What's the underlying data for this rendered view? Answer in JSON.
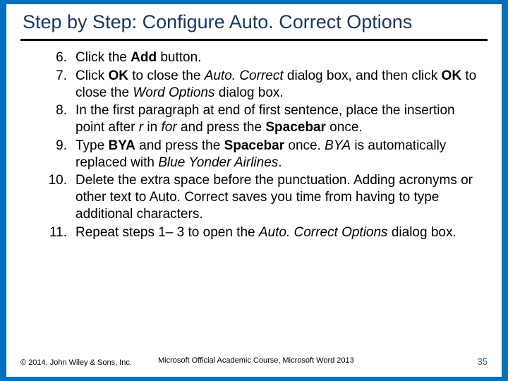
{
  "title": "Step by Step: Configure Auto. Correct Options",
  "steps": [
    {
      "num": "6.",
      "parts": [
        {
          "t": "Click the "
        },
        {
          "t": "Add",
          "b": true
        },
        {
          "t": " button."
        }
      ]
    },
    {
      "num": "7.",
      "parts": [
        {
          "t": "Click "
        },
        {
          "t": "OK",
          "b": true
        },
        {
          "t": " to close the "
        },
        {
          "t": "Auto. Correct",
          "i": true
        },
        {
          "t": " dialog box, and then click "
        },
        {
          "t": "OK",
          "b": true
        },
        {
          "t": " to close the "
        },
        {
          "t": "Word Options",
          "i": true
        },
        {
          "t": " dialog box."
        }
      ]
    },
    {
      "num": "8.",
      "parts": [
        {
          "t": "In the first paragraph at end of first sentence, place the insertion point after "
        },
        {
          "t": "r",
          "i": true
        },
        {
          "t": " in "
        },
        {
          "t": "for",
          "i": true
        },
        {
          "t": " and press the "
        },
        {
          "t": "Spacebar",
          "b": true
        },
        {
          "t": " once."
        }
      ]
    },
    {
      "num": "9.",
      "parts": [
        {
          "t": "Type "
        },
        {
          "t": "BYA",
          "b": true
        },
        {
          "t": " and press the "
        },
        {
          "t": "Spacebar",
          "b": true
        },
        {
          "t": " once. "
        },
        {
          "t": "BYA",
          "i": true
        },
        {
          "t": " is automatically replaced with "
        },
        {
          "t": "Blue Yonder Airlines",
          "i": true
        },
        {
          "t": "."
        }
      ]
    },
    {
      "num": "10.",
      "parts": [
        {
          "t": "Delete the extra space before the punctuation. Adding acronyms or other text to Auto. Correct saves you time from having to type additional characters."
        }
      ]
    },
    {
      "num": "11.",
      "parts": [
        {
          "t": "Repeat steps 1– 3 to open the "
        },
        {
          "t": "Auto. Correct Options",
          "i": true
        },
        {
          "t": " dialog box."
        }
      ]
    }
  ],
  "footer": {
    "copyright": "© 2014, John Wiley & Sons, Inc.",
    "course": "Microsoft Official Academic Course, Microsoft Word 2013",
    "page": "35"
  }
}
